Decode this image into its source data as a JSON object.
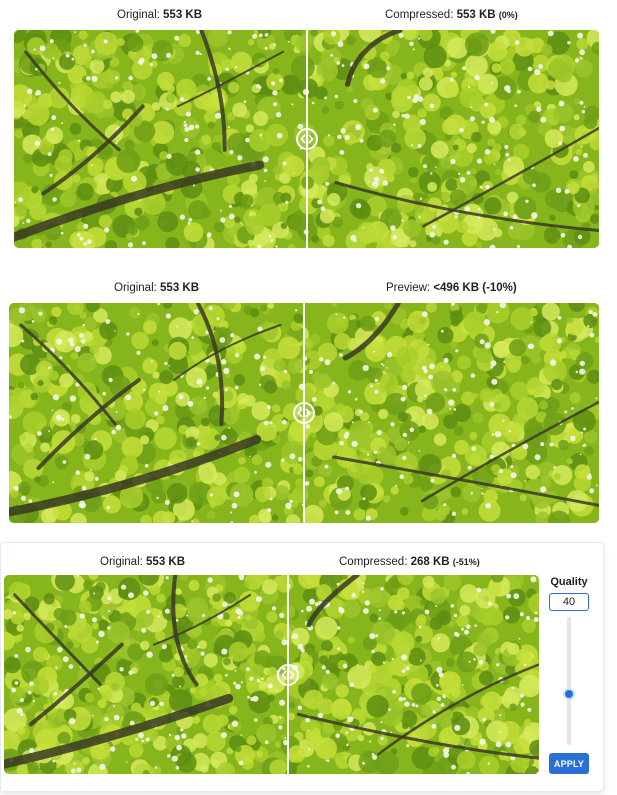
{
  "comparisons": [
    {
      "left_prefix": "Original:",
      "left_size": "553 KB",
      "right_prefix": "Compressed:",
      "right_size": "553 KB",
      "right_delta": "(0%)",
      "divider_position": 0.5
    },
    {
      "left_prefix": "Original:",
      "left_size": "553 KB",
      "right_prefix": "Preview:",
      "right_size": "<496 KB",
      "right_delta": "(-10%)",
      "divider_position": 0.5
    },
    {
      "left_prefix": "Original:",
      "left_size": "553 KB",
      "right_prefix": "Compressed:",
      "right_size": "268 KB",
      "right_delta": "(-51%)",
      "divider_position": 0.53
    }
  ],
  "quality": {
    "title": "Quality",
    "value": "40",
    "slider_fraction": 0.4,
    "apply_label": "APPLY"
  },
  "colors": {
    "accent": "#2b6fd6",
    "foliage": "#8cbc1f"
  }
}
